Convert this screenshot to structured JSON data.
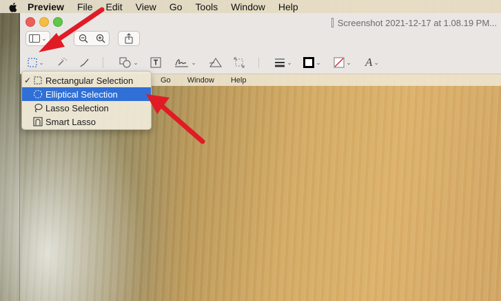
{
  "menubar": {
    "app_name": "Preview",
    "items": [
      "File",
      "Edit",
      "View",
      "Go",
      "Tools",
      "Window",
      "Help"
    ]
  },
  "window": {
    "title": "Screenshot 2021-12-17 at 1.08.19 PM..."
  },
  "inner_menubar": {
    "items": [
      "Go",
      "Window",
      "Help"
    ]
  },
  "selection_menu": {
    "items": [
      {
        "label": "Rectangular Selection",
        "checked": true,
        "icon": "rectangular-selection-icon"
      },
      {
        "label": "Elliptical Selection",
        "highlighted": true,
        "icon": "elliptical-selection-icon"
      },
      {
        "label": "Lasso Selection",
        "icon": "lasso-icon"
      },
      {
        "label": "Smart Lasso",
        "icon": "smart-lasso-icon"
      }
    ]
  },
  "colors": {
    "highlight": "#2f6fd6",
    "annotation_arrow": "#e01b25"
  }
}
